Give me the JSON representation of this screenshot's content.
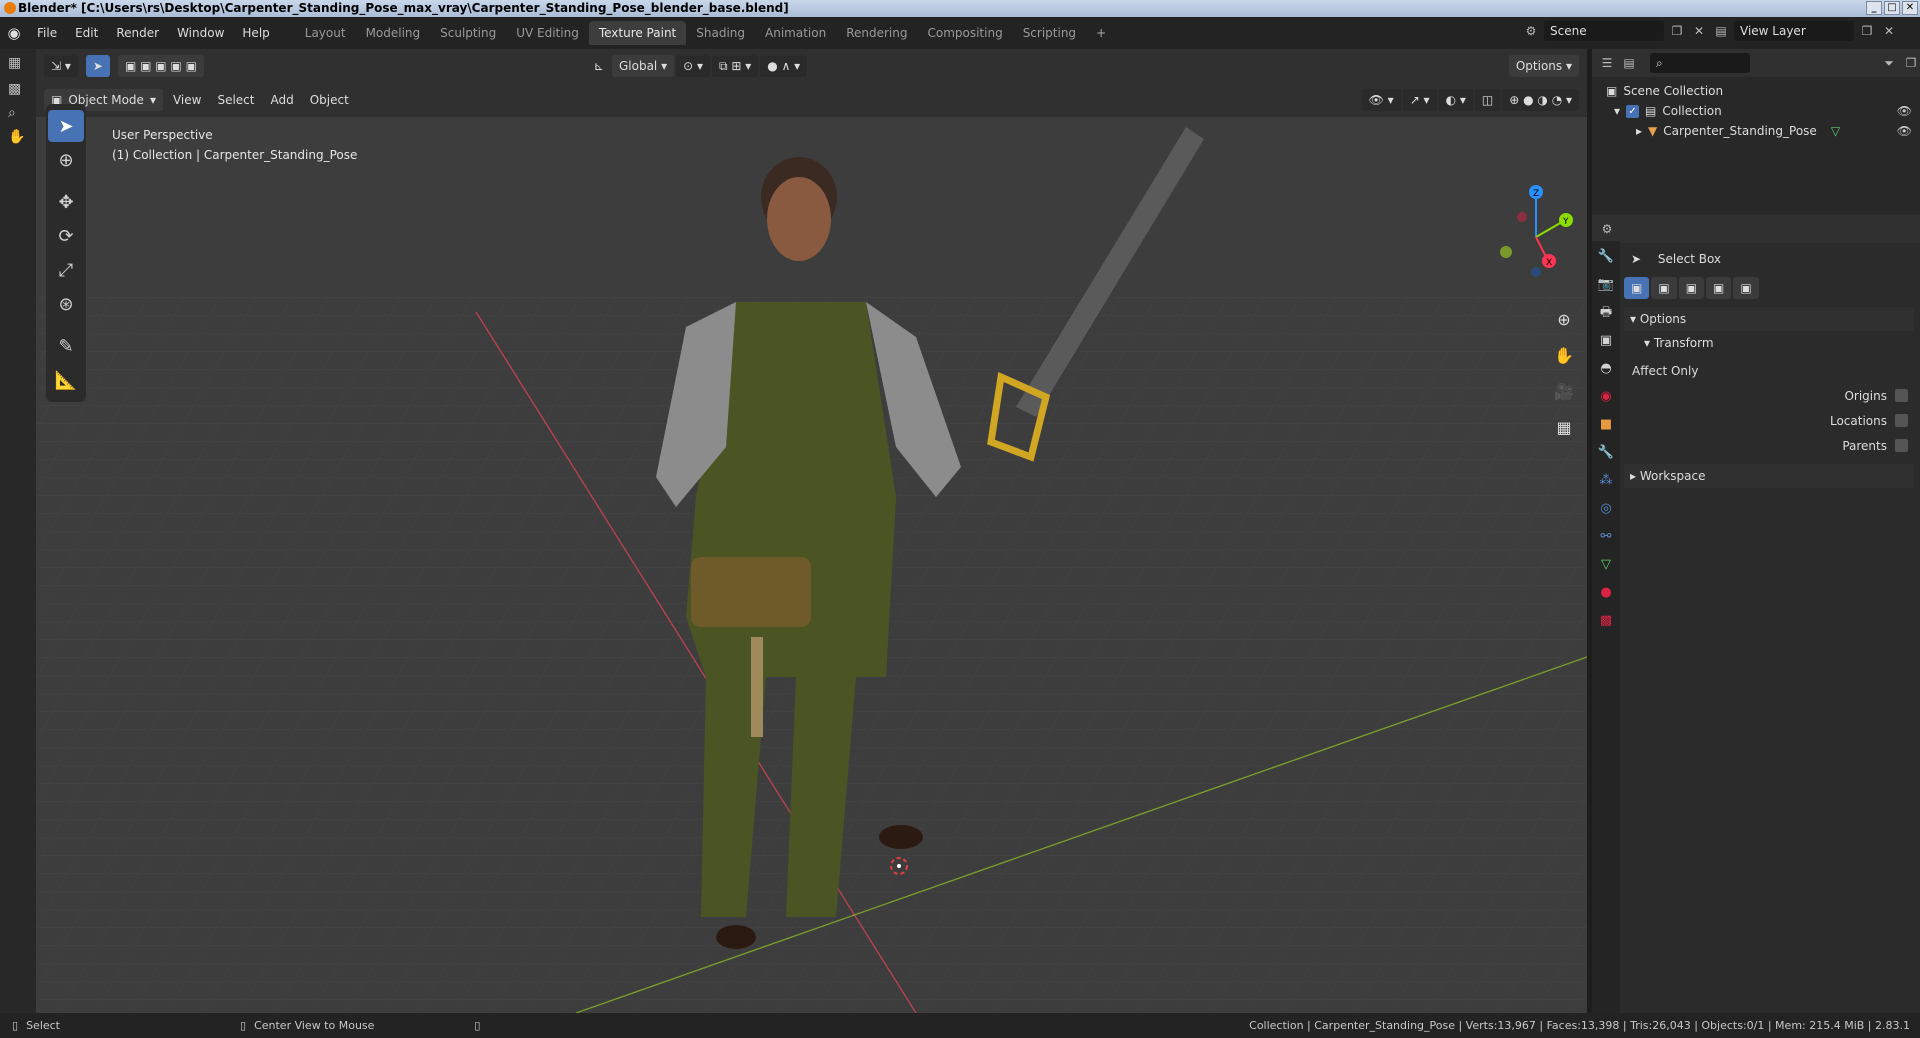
{
  "window": {
    "title": "Blender* [C:\\Users\\rs\\Desktop\\Carpenter_Standing_Pose_max_vray\\Carpenter_Standing_Pose_blender_base.blend]"
  },
  "menu": [
    "File",
    "Edit",
    "Render",
    "Window",
    "Help"
  ],
  "workspaces": [
    "Layout",
    "Modeling",
    "Sculpting",
    "UV Editing",
    "Texture Paint",
    "Shading",
    "Animation",
    "Rendering",
    "Compositing",
    "Scripting"
  ],
  "active_workspace": "Texture Paint",
  "scene": {
    "name": "Scene",
    "view_layer": "View Layer"
  },
  "header": {
    "orientation": "Global",
    "options": "Options",
    "mode": "Object Mode",
    "menus": [
      "View",
      "Select",
      "Add",
      "Object"
    ]
  },
  "viewport": {
    "perspective": "User Perspective",
    "collection_info": "(1) Collection | Carpenter_Standing_Pose",
    "gizmo_axes": [
      "X",
      "Y",
      "Z"
    ]
  },
  "outliner": {
    "root": "Scene Collection",
    "collection": "Collection",
    "object": "Carpenter_Standing_Pose"
  },
  "properties": {
    "tool_name": "Select Box",
    "options_label": "Options",
    "transform_label": "Transform",
    "affect_only_label": "Affect Only",
    "checkboxes": [
      "Origins",
      "Locations",
      "Parents"
    ],
    "workspace_label": "Workspace"
  },
  "status": {
    "left_select": "Select",
    "center_view": "Center View to Mouse",
    "stats": "Collection | Carpenter_Standing_Pose | Verts:13,967 | Faces:13,398 | Tris:26,043 | Objects:0/1 | Mem: 215.4 MiB | 2.83.1"
  },
  "colors": {
    "accent": "#4772b3",
    "x_axis": "#ff3352",
    "y_axis": "#8bdc00",
    "z_axis": "#2890ff",
    "viewport_bg": "#3d3d3d"
  }
}
